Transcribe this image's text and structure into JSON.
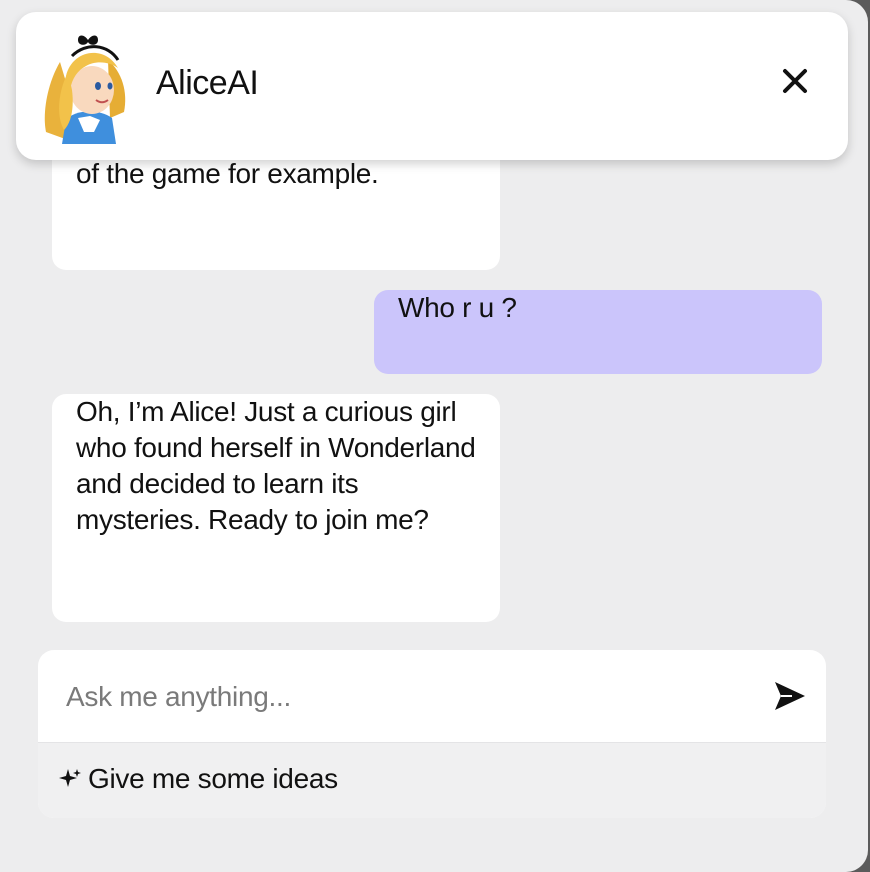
{
  "header": {
    "title": "AliceAI",
    "avatar_icon": "alice-avatar",
    "close_icon": "close-icon"
  },
  "messages": [
    {
      "role": "assistant",
      "partial_line": "",
      "text": "You can ask me about the rules of the game for example."
    },
    {
      "role": "user",
      "text": "Who r u ?"
    },
    {
      "role": "assistant",
      "text": "Oh, I’m Alice! Just a curious girl who found herself in Wonderland and decided to learn its mysteries. Ready to join me?"
    }
  ],
  "composer": {
    "placeholder": "Ask me anything...",
    "value": "",
    "send_icon": "send-icon",
    "ideas_label": "Give me some ideas",
    "ideas_icon": "sparkle-icon"
  },
  "colors": {
    "panel_bg": "#ededee",
    "user_bubble": "#cbc5fb",
    "bot_bubble": "#ffffff"
  }
}
